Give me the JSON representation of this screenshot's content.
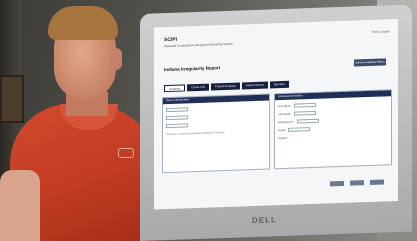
{
  "screen": {
    "app_title": "SCIPI",
    "app_subtitle": "Standard Comparative Integrated Reporting System",
    "app_right_text": "Help | Logout",
    "page_title": "Indiana Irregularity Report",
    "page_button": "Submit Irregularity Report",
    "tabs": [
      "Incidents",
      "Create Info",
      "Protest & Inquiry",
      "Follow Review",
      "Narrative"
    ],
    "left_panel_title": "Report Identification",
    "right_panel_title": "Individual Information",
    "right_fields": [
      "First Name",
      "Last Name",
      "Employee No",
      "Grade",
      "Position"
    ],
    "checkbox_text": "Check Box if Incident Has Not Been Identified By This Editor"
  },
  "laptop": {
    "brand": "DELL"
  },
  "colors": {
    "shirt": "#c03c22",
    "screen_bg": "#f4f6f8",
    "header_navy": "#1f2f57"
  }
}
